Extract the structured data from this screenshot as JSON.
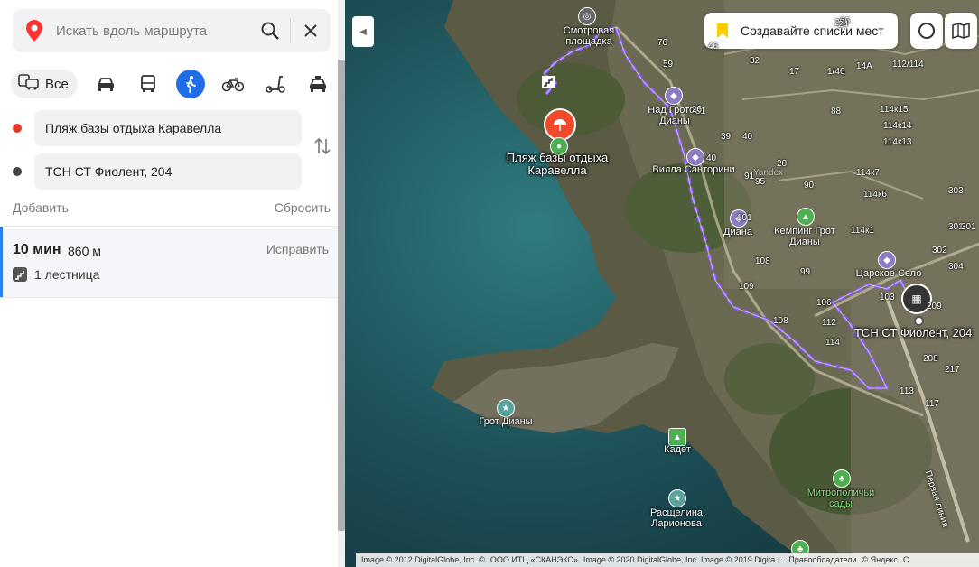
{
  "search": {
    "placeholder": "Искать вдоль маршрута"
  },
  "modes": {
    "all_label": "Все"
  },
  "route_points": {
    "from": "Пляж базы отдыха Каравелла",
    "to": "ТСН СТ Фиолент, 204"
  },
  "actions": {
    "add": "Добавить",
    "reset": "Сбросить"
  },
  "route": {
    "time": "10 мин",
    "distance": "860 м",
    "edit": "Исправить",
    "feature": "1 лестница"
  },
  "colors": {
    "accent": "#1f6ee8",
    "start": "#e8352b",
    "end": "#444444",
    "route_line": "#8b5cf6"
  },
  "map": {
    "promo": "Создавайте списки мест",
    "places": {
      "from_label": "Пляж базы отдыха Каравелла",
      "to_label": "ТСН СТ Фиолент, 204"
    },
    "pois": {
      "smotrovaya": "Смотровая площадка",
      "nad_grotom": "Над Гротом Дианы",
      "villa": "Вилла Санторини",
      "diana": "Диана",
      "kemping": "Кемпинг Грот Дианы",
      "tsarskoe": "Царское Село",
      "grot": "Грот Дианы",
      "kadet": "Кадет",
      "rasshchelina": "Расщелина Ларионова",
      "mitropolichi": "Митрополичьи сады"
    },
    "street": "Первая линия",
    "yandex": "Yandex",
    "house_numbers": [
      "76",
      "46",
      "32",
      "59",
      "17",
      "1/46",
      "14А",
      "112/114",
      "81",
      "88",
      "114к15",
      "114к14",
      "114к13",
      "114к7",
      "114к6",
      "114к1",
      "26",
      "39",
      "40",
      "40",
      "91",
      "20",
      "95",
      "90",
      "101",
      "99",
      "108",
      "109",
      "106",
      "108",
      "112",
      "114",
      "103",
      "209",
      "208",
      "217",
      "113",
      "117",
      "301",
      "302",
      "304",
      "303",
      "301",
      "26",
      "25",
      "24"
    ],
    "attribution": [
      "Image © 2012 DigitalGlobe, Inc. ©",
      "ООО ИТЦ «СКАНЭКС»",
      "Image © 2020 DigitalGlobe, Inc. Image © 2019 Digita…",
      "Правообладатели",
      "© Яндекс",
      "С"
    ]
  }
}
